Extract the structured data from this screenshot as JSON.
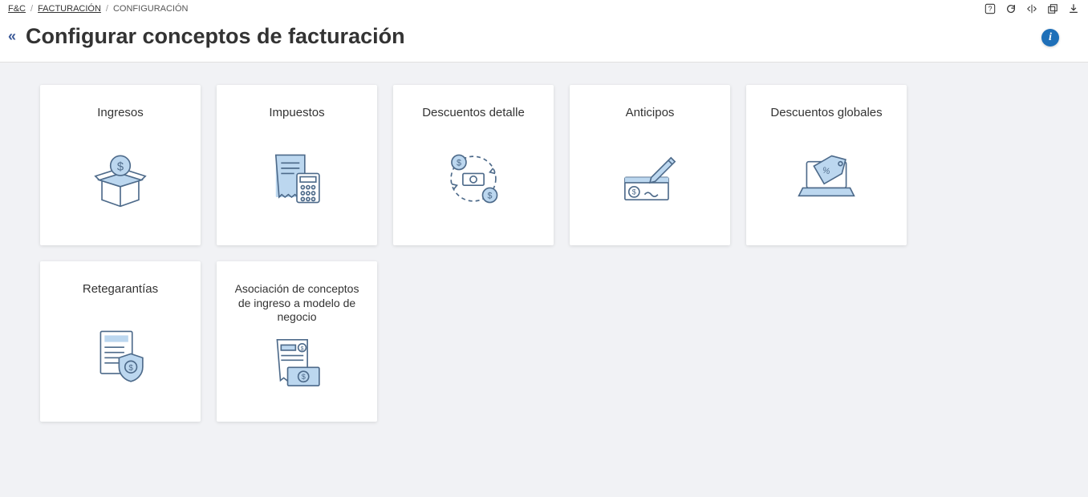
{
  "breadcrumb": {
    "root": "F&C",
    "level1": "FACTURACIÓN",
    "current": "CONFIGURACIÓN"
  },
  "header": {
    "title": "Configurar conceptos de facturación"
  },
  "cards": [
    {
      "label": "Ingresos",
      "icon": "box-money"
    },
    {
      "label": "Impuestos",
      "icon": "receipt-calc"
    },
    {
      "label": "Descuentos detalle",
      "icon": "cash-cycle"
    },
    {
      "label": "Anticipos",
      "icon": "check-sign"
    },
    {
      "label": "Descuentos globales",
      "icon": "laptop-tag"
    },
    {
      "label": "Retegarantías",
      "icon": "doc-shield"
    },
    {
      "label": "Asociación de conceptos de ingreso a modelo de negocio",
      "icon": "invoice-cash"
    }
  ],
  "info_badge": "i"
}
